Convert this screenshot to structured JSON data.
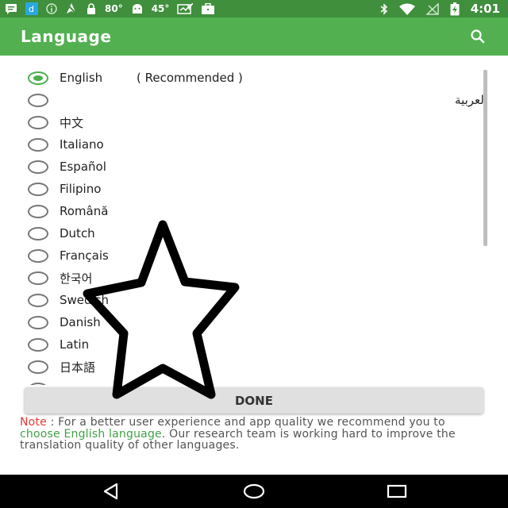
{
  "status_bar": {
    "temp1": "80°",
    "temp2": "45°",
    "time": "4:01",
    "icons": [
      "message-icon",
      "d-app-icon",
      "info-icon",
      "no-location-icon",
      "lock-icon",
      "android-icon",
      "photo-check-icon",
      "briefcase-icon",
      "bluetooth-icon",
      "wifi-icon",
      "no-signal-icon",
      "battery-charging-icon"
    ]
  },
  "app_bar": {
    "title": "Language",
    "search_icon": "search-icon",
    "color": "#52b050"
  },
  "languages": [
    {
      "label": "English",
      "note": "( Recommended )",
      "selected": true
    },
    {
      "label": "العربية",
      "rtl": true,
      "selected": false
    },
    {
      "label": "中文",
      "selected": false
    },
    {
      "label": "Italiano",
      "selected": false
    },
    {
      "label": "Español",
      "selected": false
    },
    {
      "label": "Filipino",
      "selected": false
    },
    {
      "label": "Română",
      "selected": false
    },
    {
      "label": "Dutch",
      "selected": false
    },
    {
      "label": "Français",
      "selected": false
    },
    {
      "label": "한국어",
      "selected": false
    },
    {
      "label": "Swedish",
      "selected": false
    },
    {
      "label": "Danish",
      "selected": false
    },
    {
      "label": "Latin",
      "selected": false
    },
    {
      "label": "日本語",
      "selected": false
    }
  ],
  "done_label": "DONE",
  "note": {
    "label": "Note",
    "text1": " : For a better user experience and app quality we recommend you to ",
    "link": "choose English language",
    "text2": ". Our research team is working hard to improve the translation quality of other languages."
  },
  "nav": {
    "back_icon": "back-icon",
    "home_icon": "home-icon",
    "recents_icon": "recents-icon"
  },
  "accent_color": "#4caf50",
  "note_color": "#e53935"
}
